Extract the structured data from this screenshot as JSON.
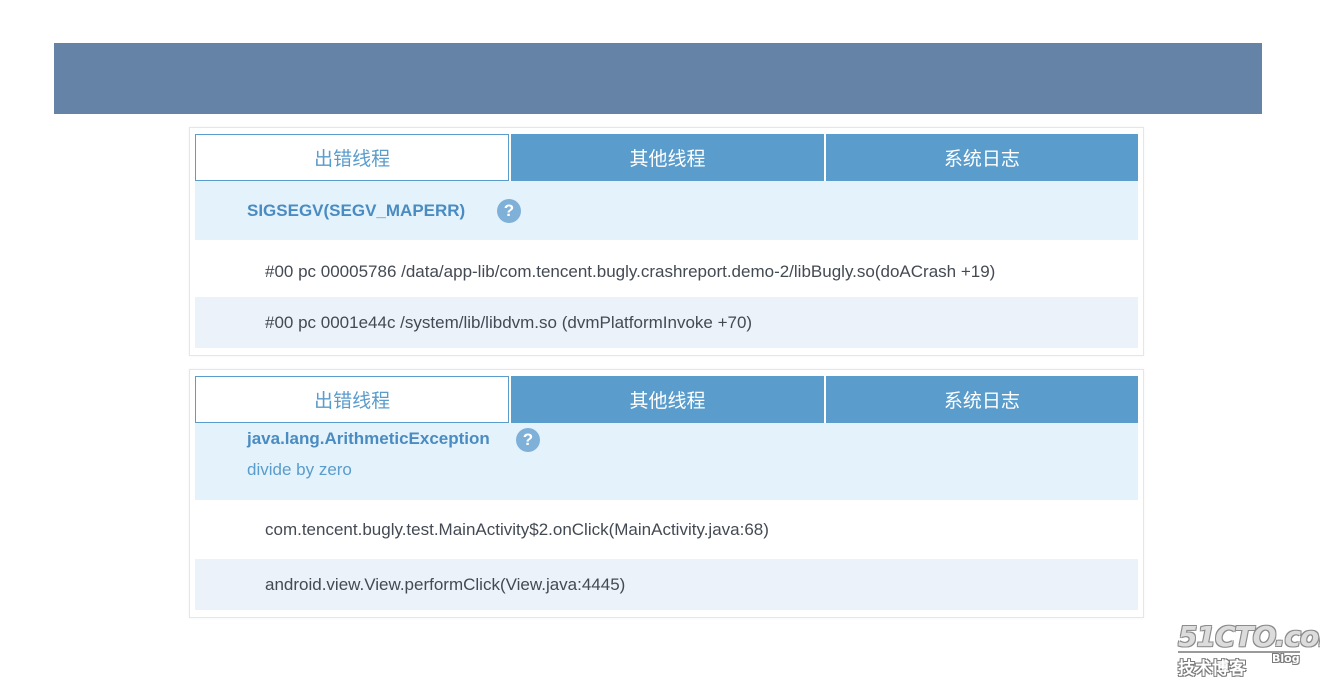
{
  "colors": {
    "header_bar": "#6583a6",
    "tab_accent": "#5a9ccb",
    "exception_bg": "#e4f2fb",
    "row_alt_bg": "#ecf2f9"
  },
  "panels": [
    {
      "tabs": [
        "出错线程",
        "其他线程",
        "系统日志"
      ],
      "active_tab": "出错线程",
      "exception": {
        "title": "SIGSEGV(SEGV_MAPERR)",
        "subtitle": "",
        "help_icon": "question-circle-icon"
      },
      "frames": [
        "#00 pc 00005786 /data/app-lib/com.tencent.bugly.crashreport.demo-2/libBugly.so(doACrash +19)",
        "#00 pc 0001e44c /system/lib/libdvm.so (dvmPlatformInvoke +70)"
      ]
    },
    {
      "tabs": [
        "出错线程",
        "其他线程",
        "系统日志"
      ],
      "active_tab": "出错线程",
      "exception": {
        "title": "java.lang.ArithmeticException",
        "subtitle": "divide by zero",
        "help_icon": "question-circle-icon"
      },
      "frames": [
        "com.tencent.bugly.test.MainActivity$2.onClick(MainActivity.java:68)",
        "android.view.View.performClick(View.java:4445)"
      ]
    }
  ],
  "watermark": {
    "main": "51CTO.com",
    "sub": "技术博客",
    "blog": "Blog"
  }
}
